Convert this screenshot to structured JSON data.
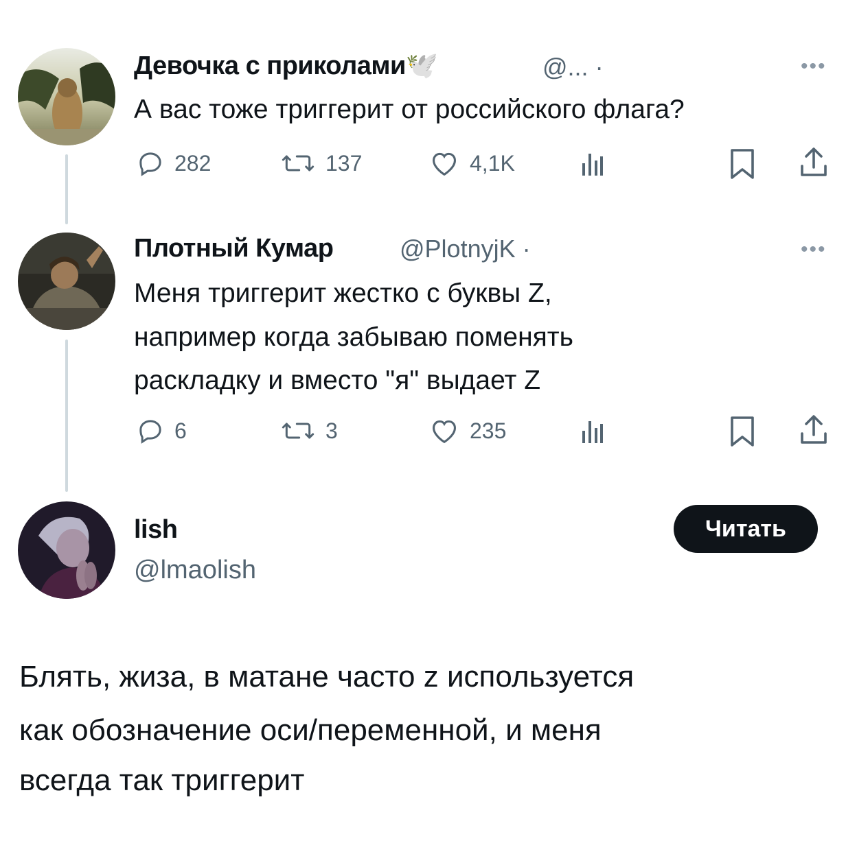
{
  "colors": {
    "text": "#0f1419",
    "secondary": "#536471",
    "thread_line": "#cfd9de",
    "button_bg": "#0f1419"
  },
  "tweet1": {
    "name": "Девочка с приколами",
    "name_emoji": "🕊️",
    "handle": "@...",
    "dot": "·",
    "more": "•••",
    "text": "А вас тоже триггерит от российского флага?",
    "actions": {
      "reply": "282",
      "retweet": "137",
      "like": "4,1K"
    }
  },
  "tweet2": {
    "name": "Плотный Кумар",
    "handle": "@PlotnyjK",
    "dot": "·",
    "more": "•••",
    "lines": [
      "Меня триггерит жестко с буквы Z,",
      "например когда забываю поменять",
      "раскладку и вместо \"я\" выдает Z"
    ],
    "actions": {
      "reply": "6",
      "retweet": "3",
      "like": "235"
    }
  },
  "main_tweet": {
    "name": "lish",
    "handle": "@lmaolish",
    "follow_label": "Читать",
    "lines": [
      "Блять, жиза, в матане часто z используется",
      "как обозначение оси/переменной, и меня",
      "всегда так триггерит"
    ]
  },
  "icons": [
    "reply-icon",
    "retweet-icon",
    "like-icon",
    "views-icon",
    "bookmark-icon",
    "share-icon"
  ]
}
